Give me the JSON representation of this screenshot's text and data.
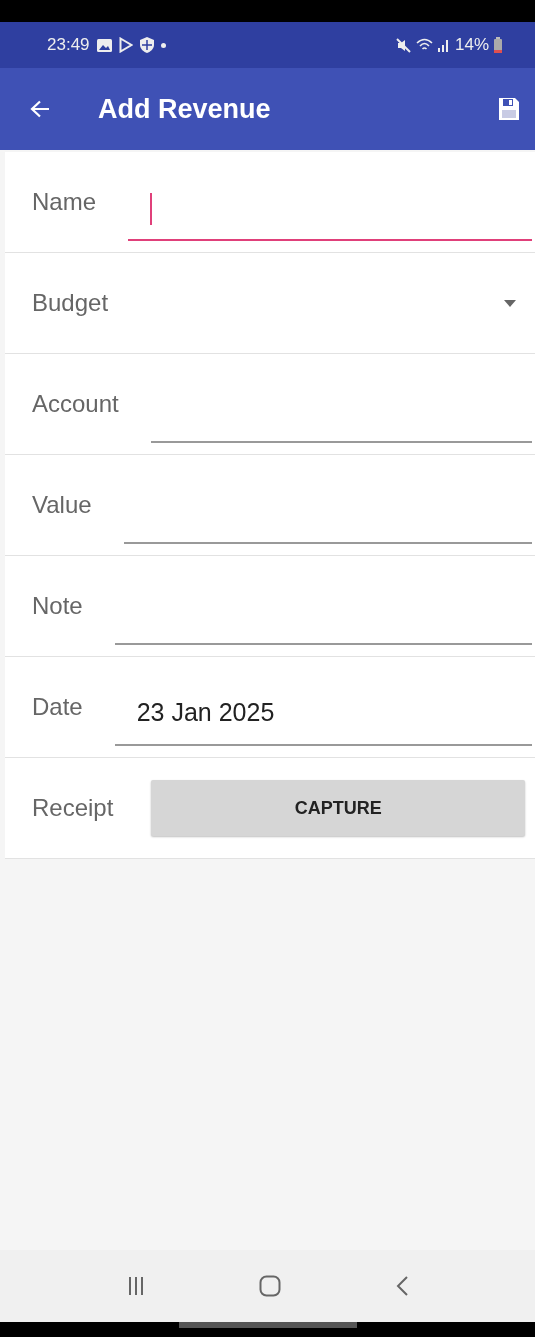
{
  "status_bar": {
    "time": "23:49",
    "battery": "14%"
  },
  "app_bar": {
    "title": "Add Revenue"
  },
  "fields": [
    {
      "label": "Name",
      "kind": "text",
      "focused": true
    },
    {
      "label": "Budget",
      "kind": "dropdown",
      "focused": false
    },
    {
      "label": "Account",
      "kind": "text",
      "focused": false
    },
    {
      "label": "Value",
      "kind": "text",
      "focused": false
    },
    {
      "label": "Note",
      "kind": "text",
      "focused": false
    },
    {
      "label": "Date",
      "kind": "text",
      "focused": false,
      "value": "23 Jan 2025"
    },
    {
      "label": "Receipt",
      "kind": "button",
      "button": "CAPTURE"
    }
  ]
}
